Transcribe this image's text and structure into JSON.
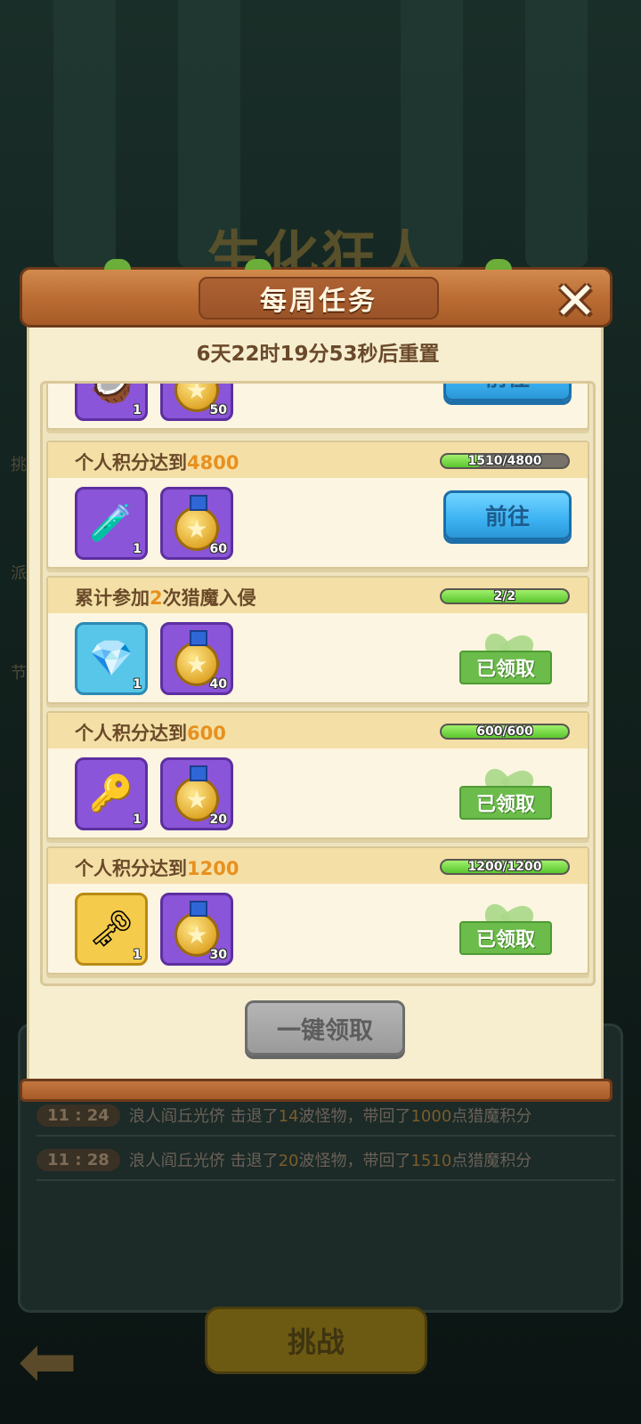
{
  "background": {
    "stage_title": "生化狂人",
    "side_labels": [
      "挑",
      "派",
      "节"
    ],
    "log": [
      {
        "time": "11 : 24",
        "text_a": "浪人阎丘光侪 击退了",
        "waves": "14",
        "text_b": "波怪物，带回了",
        "points": "1000",
        "text_c": "点猎魔积分"
      },
      {
        "time": "11 : 28",
        "text_a": "浪人阎丘光侪 击退了",
        "waves": "20",
        "text_b": "波怪物，带回了",
        "points": "1510",
        "text_c": "点猎魔积分"
      }
    ],
    "challenge_label": "挑战",
    "back_icon": "back-arrow-icon"
  },
  "modal": {
    "title": "每周任务",
    "close_icon": "close-icon",
    "reset_text": "6天22时19分53秒后重置",
    "partial_task": {
      "rewards": [
        {
          "icon": "potion-icon",
          "count": "1"
        },
        {
          "icon": "medal-icon",
          "count": "50"
        }
      ],
      "button": "前往"
    },
    "tasks": [
      {
        "title_prefix": "个人积分达到",
        "title_value": "4800",
        "title_suffix": "",
        "progress_text": "1510/4800",
        "progress": 0.3146,
        "rewards": [
          {
            "icon": "potion-icon",
            "count": "1"
          },
          {
            "icon": "medal-icon",
            "count": "60"
          }
        ],
        "state": "go",
        "button": "前往"
      },
      {
        "title_prefix": "累计参加",
        "title_value": "2",
        "title_suffix": "次猎魔入侵",
        "progress_text": "2/2",
        "progress": 1,
        "rewards": [
          {
            "icon": "mystery-crystal-icon",
            "count": "1"
          },
          {
            "icon": "medal-icon",
            "count": "40"
          }
        ],
        "state": "claimed",
        "button": "已领取"
      },
      {
        "title_prefix": "个人积分达到",
        "title_value": "600",
        "title_suffix": "",
        "progress_text": "600/600",
        "progress": 1,
        "rewards": [
          {
            "icon": "silver-key-icon",
            "count": "1"
          },
          {
            "icon": "medal-icon",
            "count": "20"
          }
        ],
        "state": "claimed",
        "button": "已领取"
      },
      {
        "title_prefix": "个人积分达到",
        "title_value": "1200",
        "title_suffix": "",
        "progress_text": "1200/1200",
        "progress": 1,
        "rewards": [
          {
            "icon": "gold-key-icon",
            "count": "1"
          },
          {
            "icon": "medal-icon",
            "count": "30"
          }
        ],
        "state": "claimed",
        "button": "已领取"
      }
    ],
    "claim_all_label": "一键领取"
  },
  "colors": {
    "highlight": "#e8901e",
    "go_button": "#3cb2f2",
    "claimed": "#6bbc4a",
    "progress_fill": "#5cc630"
  }
}
